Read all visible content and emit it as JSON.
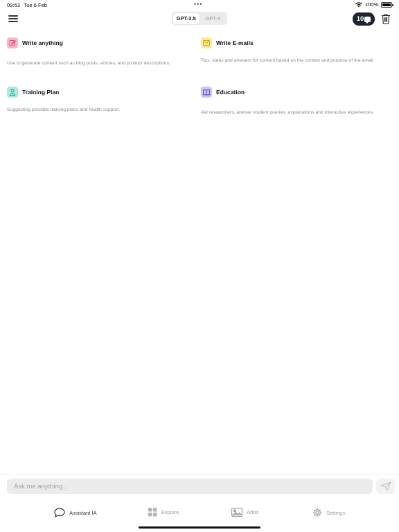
{
  "status_bar": {
    "time": "09:53",
    "date": "Tue 6 Feb",
    "dots": "•••",
    "battery": "100%"
  },
  "header": {
    "model_tabs": [
      {
        "label": "GPT-3.5",
        "active": true
      },
      {
        "label": "GPT-4",
        "active": false
      }
    ],
    "credits": "10"
  },
  "cards": [
    {
      "title": "Write anything",
      "description": "Use to generate content such as blog posts, articles, and product descriptions.",
      "icon": "pencil-icon",
      "color": "#f6b8c7"
    },
    {
      "title": "Write E-mails",
      "description": "Tips, ideas and anwsers for content based on the context and purpose of the email.",
      "icon": "envelope-icon",
      "color": "#fde99a"
    },
    {
      "title": "Training Plan",
      "description": "Suggesting possible training plans and health support.",
      "icon": "person-icon",
      "color": "#a9ecdf"
    },
    {
      "title": "Education",
      "description": "Aid researchers, anwser student queries, explanations and interactive experiences.",
      "icon": "book-icon",
      "color": "#c9c6f5"
    }
  ],
  "input": {
    "placeholder": "Ask me anything..."
  },
  "tabs": [
    {
      "label": "Assistant IA",
      "icon": "chat-icon",
      "active": true
    },
    {
      "label": "Explore",
      "icon": "grid-icon",
      "active": false
    },
    {
      "label": "Artist",
      "icon": "image-icon",
      "active": false
    },
    {
      "label": "Settings",
      "icon": "gear-icon",
      "active": false
    }
  ],
  "colors": {
    "accent_dark": "#1f2430",
    "input_bg": "#ececec",
    "muted_text": "#8a8a8a"
  }
}
